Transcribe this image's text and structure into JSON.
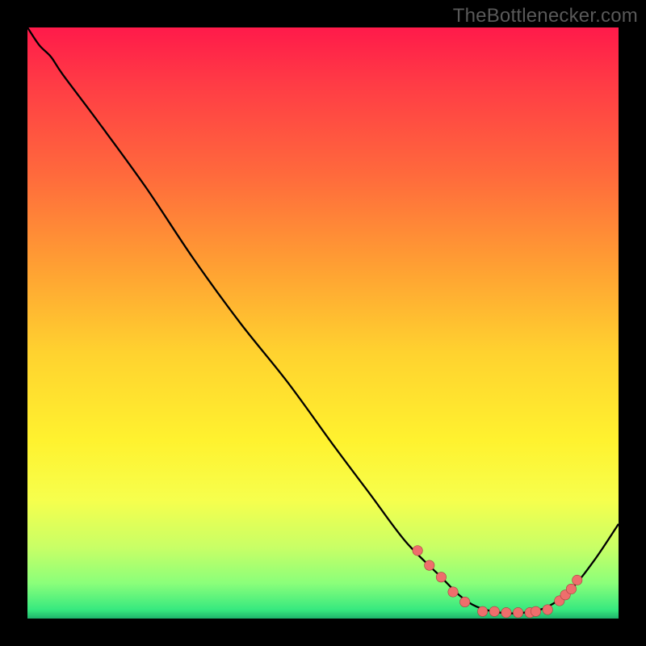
{
  "watermark": "TheBottlenecker.com",
  "colors": {
    "bg": "#000000",
    "gradient_stops": [
      {
        "offset": 0.0,
        "color": "#ff1a4a"
      },
      {
        "offset": 0.1,
        "color": "#ff3d45"
      },
      {
        "offset": 0.25,
        "color": "#ff6a3c"
      },
      {
        "offset": 0.4,
        "color": "#ff9e33"
      },
      {
        "offset": 0.55,
        "color": "#ffd22f"
      },
      {
        "offset": 0.7,
        "color": "#fff22f"
      },
      {
        "offset": 0.8,
        "color": "#f6ff4d"
      },
      {
        "offset": 0.88,
        "color": "#c8ff66"
      },
      {
        "offset": 0.94,
        "color": "#8bff7a"
      },
      {
        "offset": 0.985,
        "color": "#37e97f"
      },
      {
        "offset": 1.0,
        "color": "#1fb36b"
      }
    ],
    "curve": "#000000",
    "marker_fill": "#ee6e6c",
    "marker_stroke": "#a63f3e"
  },
  "chart_data": {
    "type": "line",
    "title": "",
    "xlabel": "",
    "ylabel": "",
    "xlim": [
      0,
      100
    ],
    "ylim": [
      0,
      100
    ],
    "series": [
      {
        "name": "curve",
        "x": [
          0,
          2,
          4,
          6,
          12,
          20,
          28,
          36,
          44,
          52,
          58,
          64,
          70,
          73,
          76,
          80,
          84,
          88,
          92,
          96,
          100
        ],
        "y": [
          100,
          97,
          95,
          92,
          84,
          73,
          61,
          50,
          40,
          29,
          21,
          13,
          7,
          4,
          2,
          1,
          1,
          2,
          5,
          10,
          16
        ]
      }
    ],
    "markers": [
      {
        "x": 66,
        "y": 11.5
      },
      {
        "x": 68,
        "y": 9.0
      },
      {
        "x": 70,
        "y": 7.0
      },
      {
        "x": 72,
        "y": 4.5
      },
      {
        "x": 74,
        "y": 2.8
      },
      {
        "x": 77,
        "y": 1.2
      },
      {
        "x": 79,
        "y": 1.2
      },
      {
        "x": 81,
        "y": 1.0
      },
      {
        "x": 83,
        "y": 1.0
      },
      {
        "x": 85,
        "y": 1.0
      },
      {
        "x": 86,
        "y": 1.2
      },
      {
        "x": 88,
        "y": 1.5
      },
      {
        "x": 90,
        "y": 3.0
      },
      {
        "x": 91,
        "y": 4.0
      },
      {
        "x": 92,
        "y": 5.0
      },
      {
        "x": 93,
        "y": 6.5
      }
    ]
  }
}
